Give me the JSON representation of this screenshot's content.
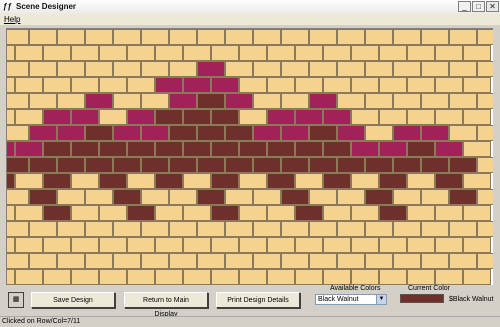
{
  "window": {
    "icon_glyph": "ƒƒ",
    "title": "Scene Designer",
    "min_glyph": "_",
    "max_glyph": "□",
    "close_glyph": "✕"
  },
  "menu": {
    "help": "Help"
  },
  "grid": {
    "rows": 16,
    "columns": 17,
    "colors": {
      "tan": "#f5d28e",
      "walnut": "#6f2f2b",
      "magenta": "#a02259"
    },
    "cells": [
      "TTTTTTTTTTTTTTTTT",
      "TTTTTTTTTTTTTTTTT",
      "TTTTTTTMTTTTTTTTT",
      "TTTTTTMMMTTTTTTTT",
      "TTTMTTMWMTTMTTTTT",
      "TTMMTMWWWTMMMTTTT",
      "TMMWMMWWWMMWMTMMT",
      "MMWWWWWWWWWWWMMWM",
      "WWWWWWWWWWWWWWWWW",
      "WTWTWTWTWTWTWTWTW",
      "TWTTWTTWTTWTTWTTW",
      "TTWTTWTTWTTWTTWTT",
      "TTTTTTTTTTTTTTTTT",
      "TTTTTTTTTTTTTTTTT",
      "TTTTTTTTTTTTTTTTT",
      "TTTTTTTTTTTTTTTTT"
    ]
  },
  "toolbar": {
    "icon_label": "▦",
    "save_label": "Save Design",
    "return_label": "Return to Main Display",
    "print_label": "Print Design Details",
    "available_colors_label": "Available Colors",
    "current_color_label": "Current Color",
    "selected_color": "Black Walnut",
    "current_color_name": "$Black Walnut",
    "current_color_hex": "#6f2f2b"
  },
  "status": {
    "text": "Clicked on Row/Col=7/11"
  }
}
